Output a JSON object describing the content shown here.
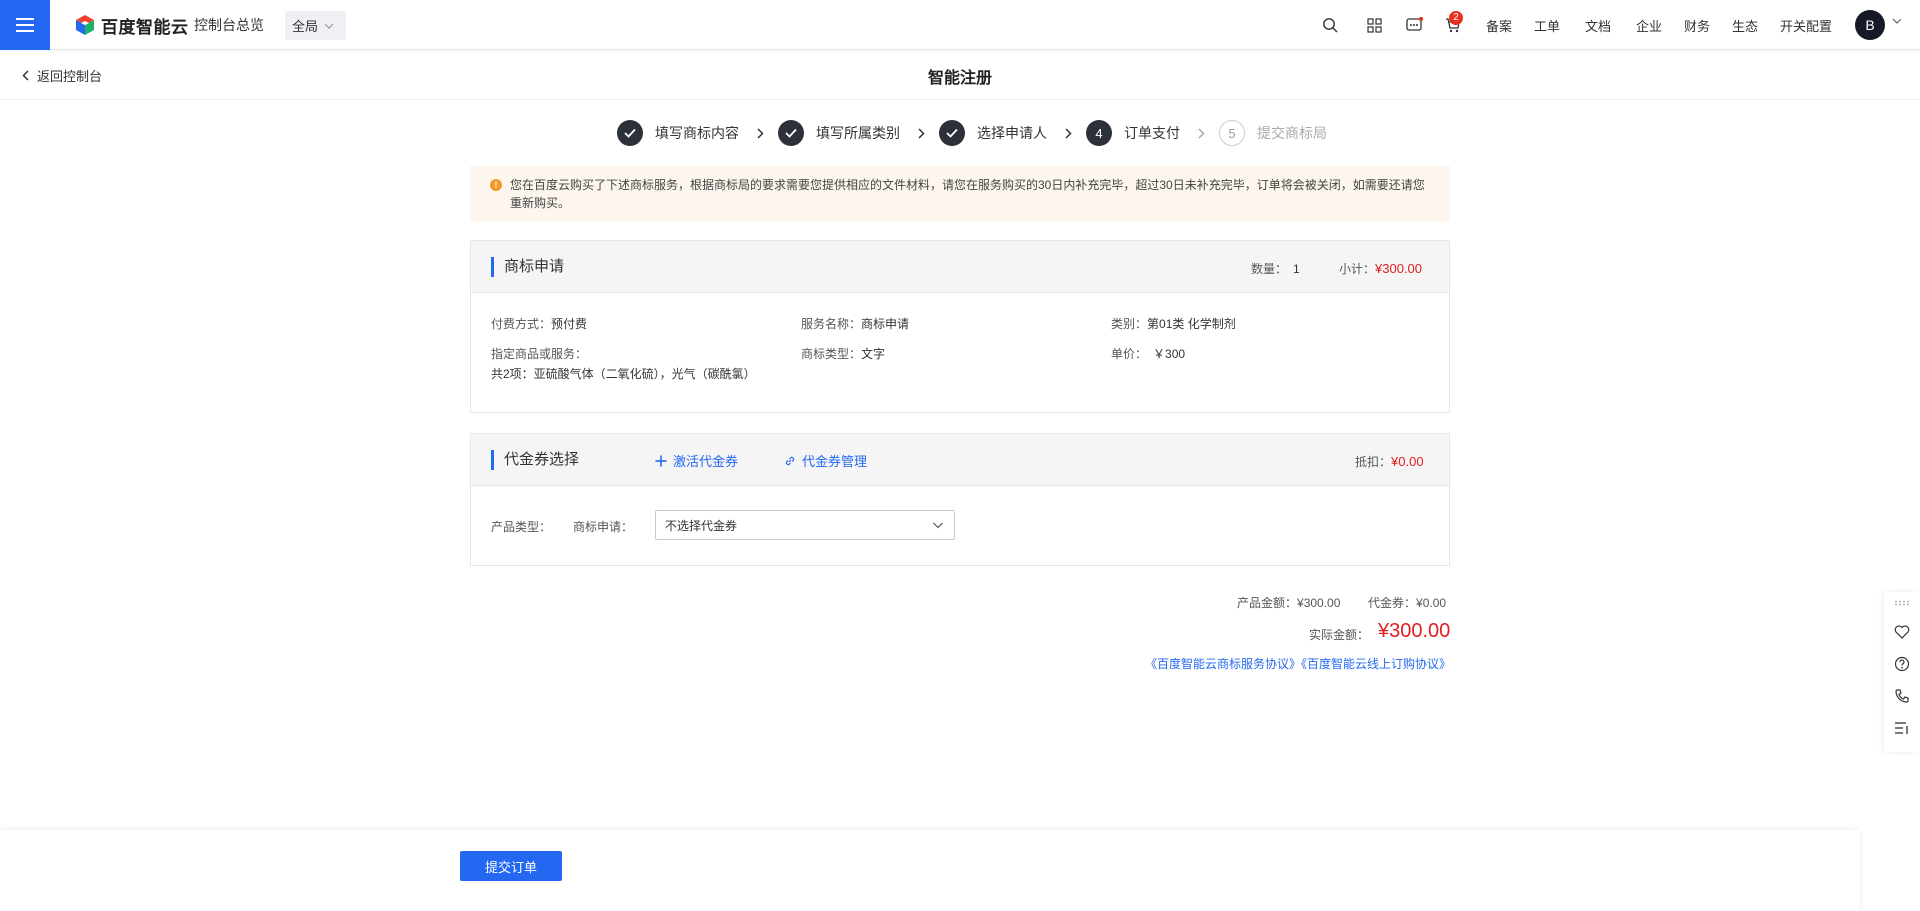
{
  "topbar": {
    "logo_text": "百度智能云",
    "console_overview": "控制台总览",
    "region": "全局",
    "cart_badge": "2",
    "nav": [
      "备案",
      "工单",
      "文档",
      "企业",
      "财务",
      "生态",
      "开关配置"
    ],
    "avatar_letter": "B"
  },
  "subheader": {
    "back_label": "返回控制台",
    "title": "智能注册"
  },
  "steps": [
    {
      "num": "",
      "label": "填写商标内容",
      "state": "done"
    },
    {
      "num": "",
      "label": "填写所属类别",
      "state": "done"
    },
    {
      "num": "",
      "label": "选择申请人",
      "state": "done"
    },
    {
      "num": "4",
      "label": "订单支付",
      "state": "current"
    },
    {
      "num": "5",
      "label": "提交商标局",
      "state": "todo"
    }
  ],
  "notice": {
    "text": "您在百度云购买了下述商标服务，根据商标局的要求需要您提供相应的文件材料，请您在服务购买的30日内补充完毕，超过30日未补充完毕，订单将会被关闭，如需要还请您重新购买。"
  },
  "order": {
    "title": "商标申请",
    "qty_label": "数量：",
    "qty": "1",
    "subtotal_label": "小计：",
    "subtotal": "¥300.00",
    "pay_label": "付费方式：",
    "pay_value": "预付费",
    "service_label": "服务名称：",
    "service_value": "商标申请",
    "category_label": "类别：",
    "category_value": "第01类 化学制剂",
    "goods_label": "指定商品或服务：",
    "goods_value": "共2项：亚硫酸气体（二氧化硫），光气（碳酰氯）",
    "type_label": "商标类型：",
    "type_value": "文字",
    "unit_label": "单价：",
    "unit_value": "￥300"
  },
  "voucher": {
    "title": "代金券选择",
    "activate": "激活代金券",
    "manage": "代金券管理",
    "deduct_label": "抵扣：",
    "deduct": "¥0.00",
    "product_type_label": "产品类型：",
    "product_name": "商标申请：",
    "select_value": "不选择代金券"
  },
  "summary": {
    "product_amount_label": "产品金额：",
    "product_amount": "¥300.00",
    "voucher_label": "代金券：",
    "voucher_amount": "¥0.00",
    "actual_label": "实际金额：",
    "actual_amount": "¥300.00",
    "agreements": "《百度智能云商标服务协议》《百度智能云线上订购协议》"
  },
  "bottom": {
    "submit": "提交订单"
  },
  "colors": {
    "primary": "#2468f2",
    "price": "#e02020",
    "notice_bg": "#fdf6ee",
    "step_done": "#2c3038"
  }
}
